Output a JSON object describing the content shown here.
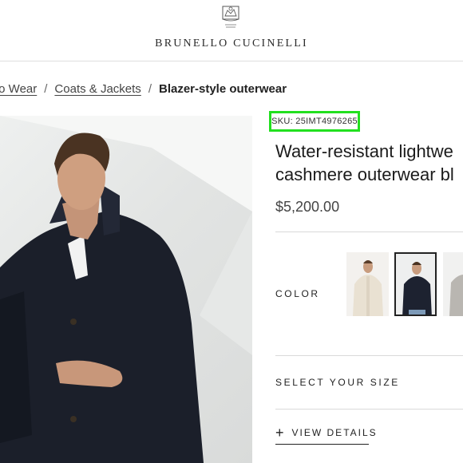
{
  "header": {
    "brand": "BRUNELLO CUCINELLI"
  },
  "breadcrumb": {
    "items": [
      "to Wear",
      "Coats & Jackets"
    ],
    "current": "Blazer-style outerwear"
  },
  "product": {
    "sku": "SKU: 25IMT4976265",
    "title_line1": "Water-resistant lightwe",
    "title_line2": "cashmere outerwear bl",
    "price": "$5,200.00",
    "color_label": "COLOR",
    "size_label": "SELECT YOUR SIZE",
    "details_label": "VIEW DETAILS",
    "details_icon": "plus-icon"
  },
  "colors": {
    "accent_highlight": "#22e01f",
    "selected_swatch_border": "#222222"
  }
}
